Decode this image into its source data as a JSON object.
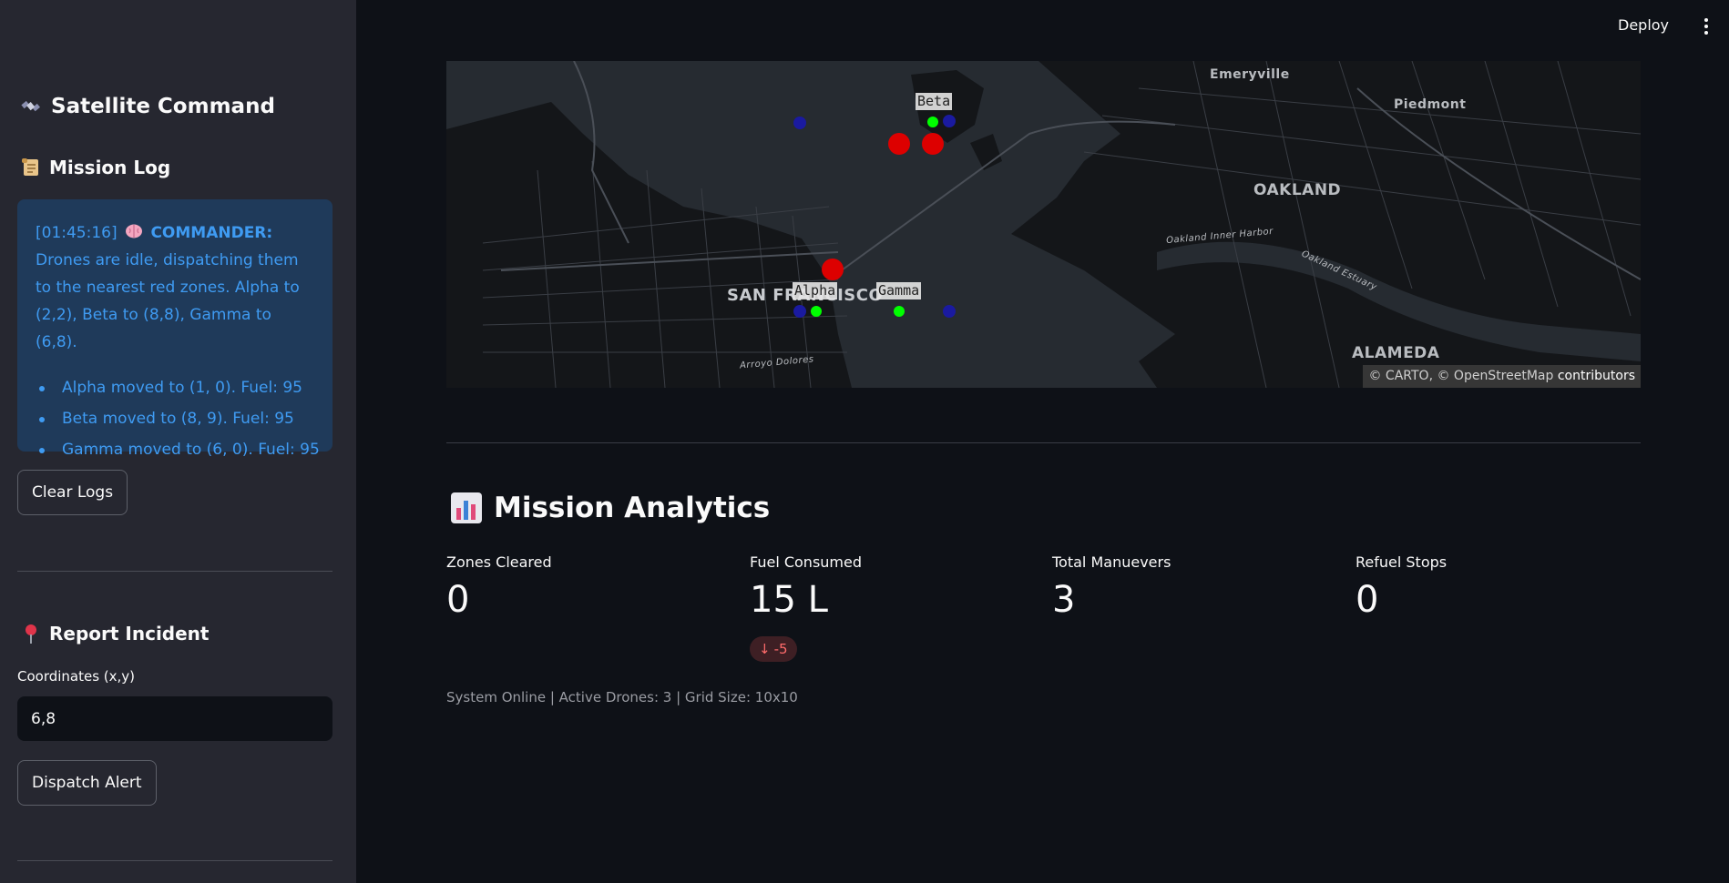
{
  "header": {
    "deploy_label": "Deploy"
  },
  "sidebar": {
    "title": "Satellite Command",
    "mission_log_heading": "Mission Log",
    "log": {
      "timestamp": "[01:45:16]",
      "speaker": "COMMANDER:",
      "message": "Drones are idle, dispatching them to the nearest red zones. Alpha to (2,2), Beta to (8,8), Gamma to (6,8).",
      "items": [
        "Alpha moved to (1, 0). Fuel: 95",
        "Beta moved to (8, 9). Fuel: 95",
        "Gamma moved to (6, 0). Fuel: 95"
      ]
    },
    "clear_logs_label": "Clear Logs",
    "report_heading": "Report Incident",
    "coordinates_label": "Coordinates (x,y)",
    "coordinates_value": "6,8",
    "dispatch_label": "Dispatch Alert"
  },
  "map": {
    "cities": [
      "Emeryville",
      "Piedmont",
      "OAKLAND",
      "SAN FRANCISCO",
      "ALAMEDA"
    ],
    "streets": [
      "Oakland Inner Harbor",
      "Oakland Estuary",
      "Arroyo Dolores"
    ],
    "drones": [
      "Alpha",
      "Beta",
      "Gamma"
    ],
    "attribution_prefix": "© CARTO, © OpenStreetMap",
    "attribution_suffix": "contributors",
    "colors": {
      "drone": "#00ff00",
      "red_zone": "#dd0000",
      "base": "#1a1aa0"
    }
  },
  "analytics": {
    "title": "Mission Analytics",
    "metrics": [
      {
        "label": "Zones Cleared",
        "value": "0"
      },
      {
        "label": "Fuel Consumed",
        "value": "15 L",
        "delta": "-5"
      },
      {
        "label": "Total Manuevers",
        "value": "3"
      },
      {
        "label": "Refuel Stops",
        "value": "0"
      }
    ],
    "status": "System Online | Active Drones: 3 | Grid Size: 10x10"
  }
}
